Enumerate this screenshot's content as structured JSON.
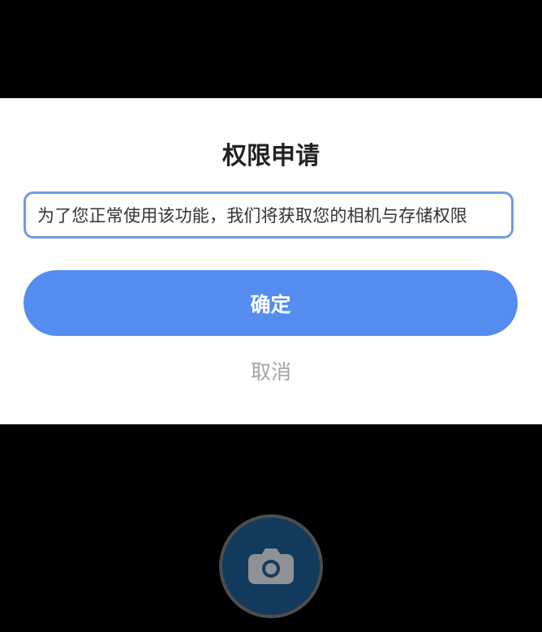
{
  "dialog": {
    "title": "权限申请",
    "message": "为了您正常使用该功能，我们将获取您的相机与存储权限",
    "confirm_label": "确定",
    "cancel_label": "取消"
  },
  "camera": {
    "shutter_icon": "camera-icon"
  },
  "colors": {
    "accent": "#548cf0",
    "message_border": "#6e9be8",
    "cancel_text": "#a4a4a4",
    "shutter_fill": "#123a5c"
  }
}
